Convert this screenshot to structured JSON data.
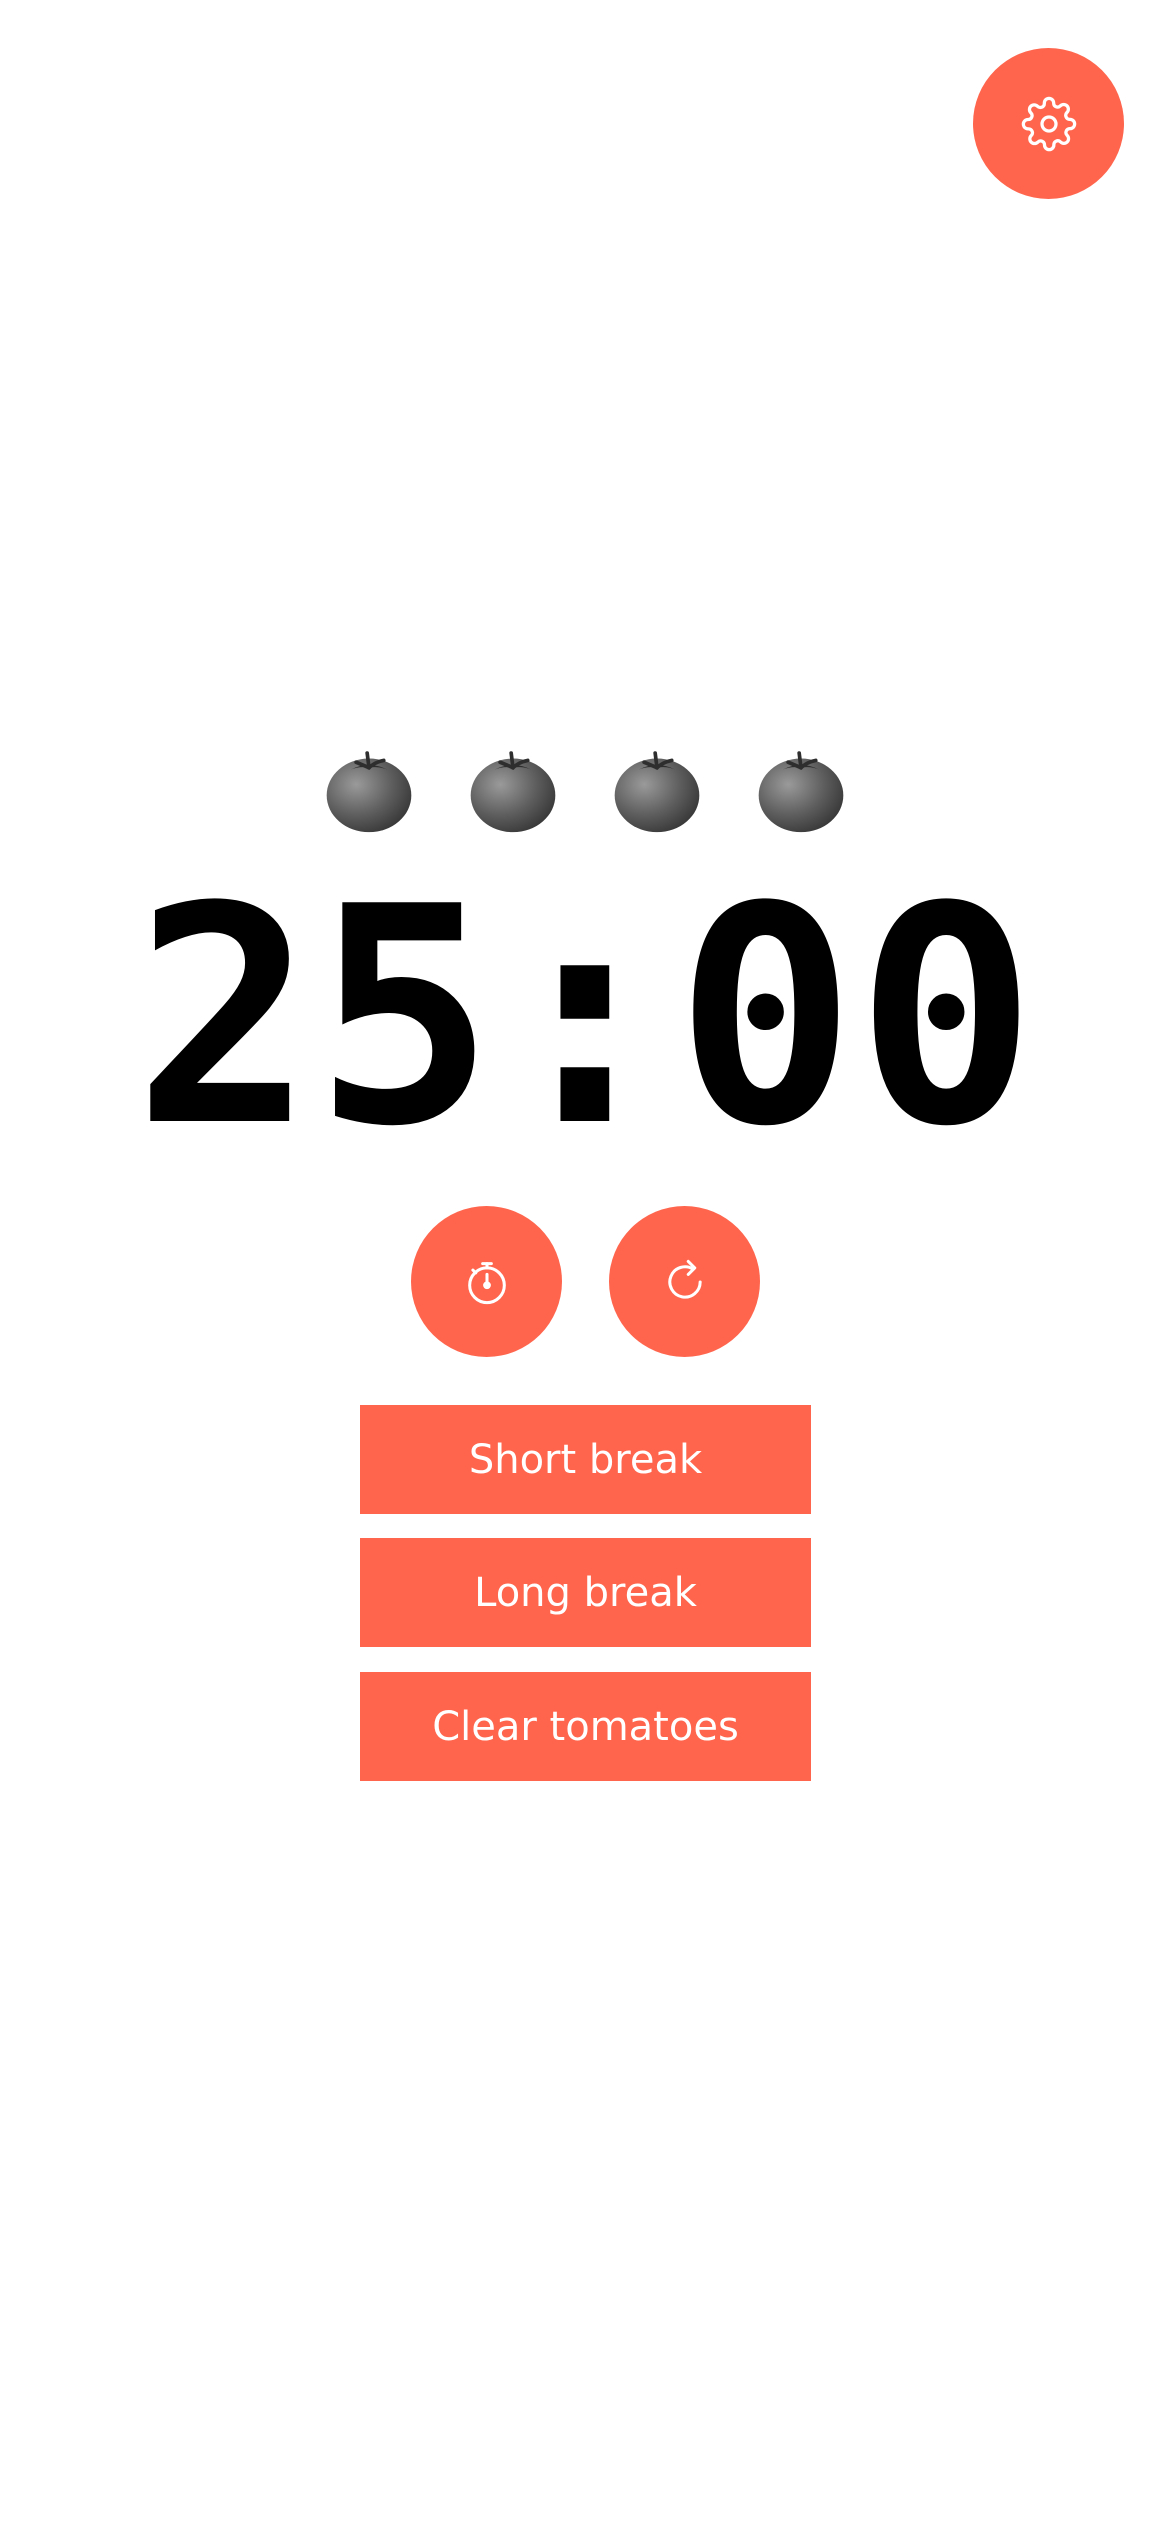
{
  "timer": {
    "display": "25:00"
  },
  "tomatoes": {
    "count": 4,
    "icon": "tomato-icon"
  },
  "controls": {
    "settings_icon": "gear-icon",
    "start_icon": "stopwatch-icon",
    "reset_icon": "rotate-right-icon"
  },
  "actions": {
    "short_break": "Short break",
    "long_break": "Long break",
    "clear_tomatoes": "Clear tomatoes"
  },
  "colors": {
    "accent": "#ff654d",
    "background": "#ffffff",
    "timer_text": "#000000",
    "button_text": "#ffffff"
  }
}
